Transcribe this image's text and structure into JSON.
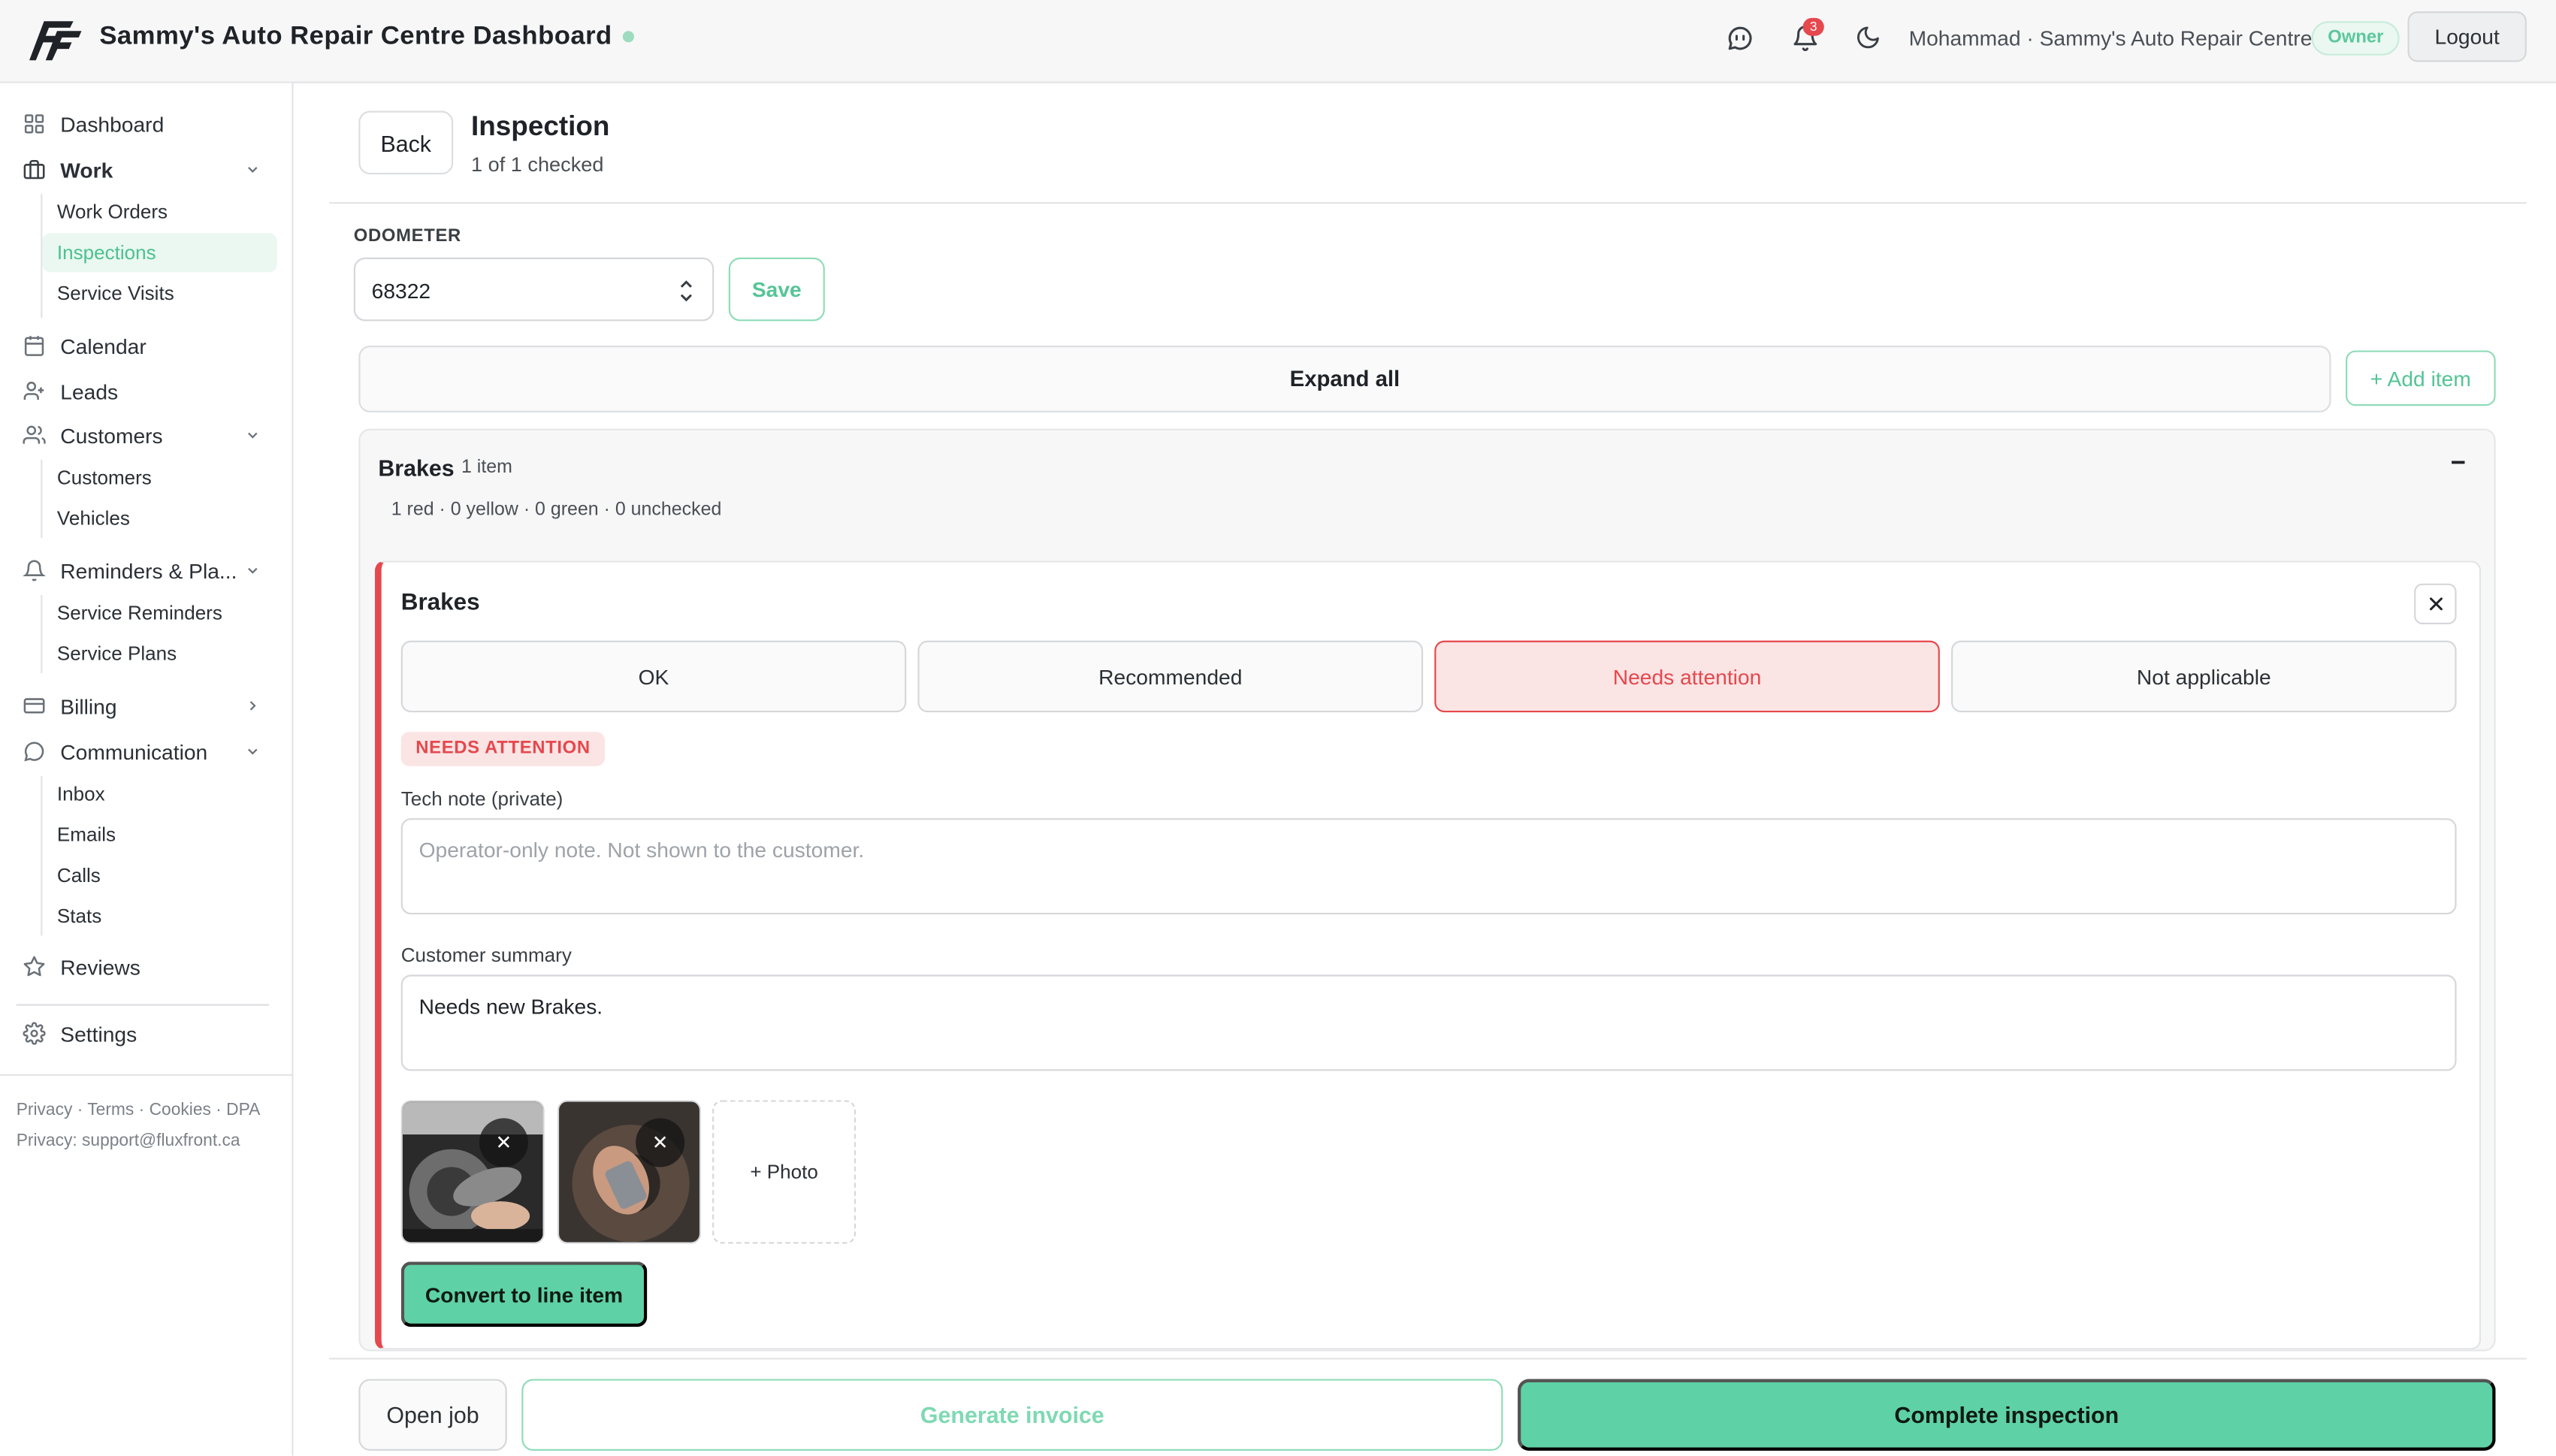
{
  "header": {
    "title": "Sammy's Auto Repair Centre Dashboard",
    "notification_count": "3",
    "user": "Mohammad · Sammy's Auto Repair Centre",
    "role_badge": "Owner",
    "logout_label": "Logout",
    "icons": [
      "logo-icon",
      "chat-icon",
      "bell-icon",
      "moon-icon"
    ]
  },
  "sidebar": {
    "items": [
      {
        "label": "Dashboard",
        "icon": "grid-icon"
      },
      {
        "label": "Work",
        "icon": "briefcase-icon",
        "expanded": true,
        "children": [
          "Work Orders",
          "Inspections",
          "Service Visits"
        ],
        "active_child": "Inspections"
      },
      {
        "label": "Calendar",
        "icon": "calendar-icon"
      },
      {
        "label": "Leads",
        "icon": "user-plus-icon"
      },
      {
        "label": "Customers",
        "icon": "users-icon",
        "expanded": true,
        "children": [
          "Customers",
          "Vehicles"
        ]
      },
      {
        "label": "Reminders & Pla...",
        "icon": "bell-icon",
        "expanded": true,
        "children": [
          "Service Reminders",
          "Service Plans"
        ]
      },
      {
        "label": "Billing",
        "icon": "card-icon",
        "expanded": false
      },
      {
        "label": "Communication",
        "icon": "message-icon",
        "expanded": true,
        "children": [
          "Inbox",
          "Emails",
          "Calls",
          "Stats"
        ]
      },
      {
        "label": "Reviews",
        "icon": "star-icon"
      },
      {
        "label": "Settings",
        "icon": "gear-icon"
      }
    ],
    "footer_links": [
      "Privacy",
      "Terms",
      "Cookies",
      "DPA"
    ],
    "footer_privacy": "Privacy: support@fluxfront.ca"
  },
  "page": {
    "back_label": "Back",
    "title": "Inspection",
    "subtitle": "1 of 1 checked",
    "odometer_label": "ODOMETER",
    "odometer_value": "68322",
    "save_label": "Save",
    "expand_all_label": "Expand all",
    "add_item_label": "+ Add item"
  },
  "section": {
    "title": "Brakes",
    "count": "1 item",
    "collapse_glyph": "−",
    "stats": "1 red · 0 yellow · 0 green · 0 unchecked",
    "item": {
      "title": "Brakes",
      "options": [
        "OK",
        "Recommended",
        "Needs attention",
        "Not applicable"
      ],
      "selected_option": "Needs attention",
      "status_pill": "NEEDS ATTENTION",
      "tech_note_label": "Tech note (private)",
      "tech_note_value": "",
      "tech_note_placeholder": "Operator-only note. Not shown to the customer.",
      "customer_summary_label": "Customer summary",
      "customer_summary_value": "Needs new Brakes.",
      "photo_count": 2,
      "add_photo_label": "+ Photo",
      "convert_label": "Convert to line item"
    }
  },
  "footer_actions": {
    "open_job": "Open job",
    "generate_invoice": "Generate invoice",
    "complete": "Complete inspection"
  },
  "colors": {
    "accent": "#5fd1a6",
    "accent_text": "#55c496",
    "danger": "#e5484d",
    "danger_bg": "#fbe4e4",
    "active_nav_bg": "#eaf8f1"
  }
}
